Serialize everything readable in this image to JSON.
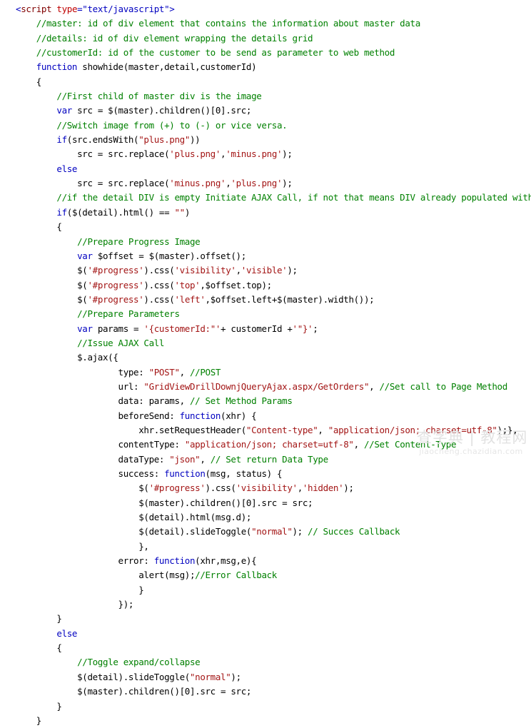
{
  "document": {
    "kind": "source-code-listing",
    "language": "JavaScript / jQuery (ASP.NET page)",
    "background_color": "#FFFFFF",
    "syntax_colors": {
      "comment": "#008000",
      "keyword": "#0000C0",
      "string": "#A31515",
      "html_tag": "#800000",
      "html_attribute": "#C00000",
      "html_bracket": "#0000C0",
      "plain_text": "#000000"
    }
  },
  "code": {
    "lines": [
      {
        "indent": 0,
        "tokens": [
          {
            "t": "br",
            "s": "<"
          },
          {
            "t": "tag",
            "s": "script "
          },
          {
            "t": "attr",
            "s": "type"
          },
          {
            "t": "val",
            "s": "=\"text/javascript\""
          },
          {
            "t": "br",
            "s": ">"
          }
        ]
      },
      {
        "indent": 1,
        "tokens": [
          {
            "t": "com",
            "s": "//master: id of div element that contains the information about master data"
          }
        ]
      },
      {
        "indent": 1,
        "tokens": [
          {
            "t": "com",
            "s": "//details: id of div element wrapping the details grid"
          }
        ]
      },
      {
        "indent": 1,
        "tokens": [
          {
            "t": "com",
            "s": "//customerId: id of the customer to be send as parameter to web method"
          }
        ]
      },
      {
        "indent": 1,
        "tokens": [
          {
            "t": "kw",
            "s": "function"
          },
          {
            "t": "plain",
            "s": " showhide(master,detail,customerId)"
          }
        ]
      },
      {
        "indent": 1,
        "tokens": [
          {
            "t": "plain",
            "s": "{"
          }
        ]
      },
      {
        "indent": 2,
        "tokens": [
          {
            "t": "com",
            "s": "//First child of master div is the image"
          }
        ]
      },
      {
        "indent": 2,
        "tokens": [
          {
            "t": "kw",
            "s": "var"
          },
          {
            "t": "plain",
            "s": " src = $(master).children()[0].src;"
          }
        ]
      },
      {
        "indent": 2,
        "tokens": [
          {
            "t": "com",
            "s": "//Switch image from (+) to (-) or vice versa."
          }
        ]
      },
      {
        "indent": 2,
        "tokens": [
          {
            "t": "kw",
            "s": "if"
          },
          {
            "t": "plain",
            "s": "(src.endsWith("
          },
          {
            "t": "str",
            "s": "\"plus.png\""
          },
          {
            "t": "plain",
            "s": "))"
          }
        ]
      },
      {
        "indent": 3,
        "tokens": [
          {
            "t": "plain",
            "s": "src = src.replace("
          },
          {
            "t": "str",
            "s": "'plus.png'"
          },
          {
            "t": "plain",
            "s": ","
          },
          {
            "t": "str",
            "s": "'minus.png'"
          },
          {
            "t": "plain",
            "s": ");"
          }
        ]
      },
      {
        "indent": 2,
        "tokens": [
          {
            "t": "kw",
            "s": "else"
          }
        ]
      },
      {
        "indent": 3,
        "tokens": [
          {
            "t": "plain",
            "s": "src = src.replace("
          },
          {
            "t": "str",
            "s": "'minus.png'"
          },
          {
            "t": "plain",
            "s": ","
          },
          {
            "t": "str",
            "s": "'plus.png'"
          },
          {
            "t": "plain",
            "s": ");"
          }
        ]
      },
      {
        "indent": 2,
        "tokens": [
          {
            "t": "com",
            "s": "//if the detail DIV is empty Initiate AJAX Call, if not that means DIV already populated with data"
          }
        ]
      },
      {
        "indent": 2,
        "tokens": [
          {
            "t": "kw",
            "s": "if"
          },
          {
            "t": "plain",
            "s": "($(detail).html() == "
          },
          {
            "t": "str",
            "s": "\"\""
          },
          {
            "t": "plain",
            "s": ")"
          }
        ]
      },
      {
        "indent": 2,
        "tokens": [
          {
            "t": "plain",
            "s": "{"
          }
        ]
      },
      {
        "indent": 3,
        "tokens": [
          {
            "t": "com",
            "s": "//Prepare Progress Image"
          }
        ]
      },
      {
        "indent": 3,
        "tokens": [
          {
            "t": "kw",
            "s": "var"
          },
          {
            "t": "plain",
            "s": " $offset = $(master).offset();"
          }
        ]
      },
      {
        "indent": 3,
        "tokens": [
          {
            "t": "plain",
            "s": "$("
          },
          {
            "t": "str",
            "s": "'#progress'"
          },
          {
            "t": "plain",
            "s": ").css("
          },
          {
            "t": "str",
            "s": "'visibility'"
          },
          {
            "t": "plain",
            "s": ","
          },
          {
            "t": "str",
            "s": "'visible'"
          },
          {
            "t": "plain",
            "s": ");"
          }
        ]
      },
      {
        "indent": 3,
        "tokens": [
          {
            "t": "plain",
            "s": "$("
          },
          {
            "t": "str",
            "s": "'#progress'"
          },
          {
            "t": "plain",
            "s": ").css("
          },
          {
            "t": "str",
            "s": "'top'"
          },
          {
            "t": "plain",
            "s": ",$offset.top);"
          }
        ]
      },
      {
        "indent": 3,
        "tokens": [
          {
            "t": "plain",
            "s": "$("
          },
          {
            "t": "str",
            "s": "'#progress'"
          },
          {
            "t": "plain",
            "s": ").css("
          },
          {
            "t": "str",
            "s": "'left'"
          },
          {
            "t": "plain",
            "s": ",$offset.left+$(master).width());"
          }
        ]
      },
      {
        "indent": 3,
        "tokens": [
          {
            "t": "com",
            "s": "//Prepare Parameters"
          }
        ]
      },
      {
        "indent": 3,
        "tokens": [
          {
            "t": "kw",
            "s": "var"
          },
          {
            "t": "plain",
            "s": " params = "
          },
          {
            "t": "str",
            "s": "'{customerId:\"'"
          },
          {
            "t": "plain",
            "s": "+ customerId +"
          },
          {
            "t": "str",
            "s": "'\"}'"
          },
          {
            "t": "plain",
            "s": ";"
          }
        ]
      },
      {
        "indent": 3,
        "tokens": [
          {
            "t": "com",
            "s": "//Issue AJAX Call"
          }
        ]
      },
      {
        "indent": 3,
        "tokens": [
          {
            "t": "plain",
            "s": "$.ajax({"
          }
        ]
      },
      {
        "indent": 5,
        "tokens": [
          {
            "t": "plain",
            "s": "type: "
          },
          {
            "t": "str",
            "s": "\"POST\""
          },
          {
            "t": "plain",
            "s": ", "
          },
          {
            "t": "com",
            "s": "//POST"
          }
        ]
      },
      {
        "indent": 5,
        "tokens": [
          {
            "t": "plain",
            "s": "url: "
          },
          {
            "t": "str",
            "s": "\"GridViewDrillDownjQueryAjax.aspx/GetOrders\""
          },
          {
            "t": "plain",
            "s": ", "
          },
          {
            "t": "com",
            "s": "//Set call to Page Method"
          }
        ]
      },
      {
        "indent": 5,
        "tokens": [
          {
            "t": "plain",
            "s": "data: params, "
          },
          {
            "t": "com",
            "s": "// Set Method Params"
          }
        ]
      },
      {
        "indent": 5,
        "tokens": [
          {
            "t": "plain",
            "s": "beforeSend: "
          },
          {
            "t": "kw",
            "s": "function"
          },
          {
            "t": "plain",
            "s": "(xhr) {"
          }
        ]
      },
      {
        "indent": 6,
        "tokens": [
          {
            "t": "plain",
            "s": "xhr.setRequestHeader("
          },
          {
            "t": "str",
            "s": "\"Content-type\""
          },
          {
            "t": "plain",
            "s": ", "
          },
          {
            "t": "str",
            "s": "\"application/json; charset=utf-8\""
          },
          {
            "t": "plain",
            "s": ");},"
          }
        ]
      },
      {
        "indent": 5,
        "tokens": [
          {
            "t": "plain",
            "s": "contentType: "
          },
          {
            "t": "str",
            "s": "\"application/json; charset=utf-8\""
          },
          {
            "t": "plain",
            "s": ", "
          },
          {
            "t": "com",
            "s": "//Set Content-Type"
          }
        ]
      },
      {
        "indent": 5,
        "tokens": [
          {
            "t": "plain",
            "s": "dataType: "
          },
          {
            "t": "str",
            "s": "\"json\""
          },
          {
            "t": "plain",
            "s": ", "
          },
          {
            "t": "com",
            "s": "// Set return Data Type"
          }
        ]
      },
      {
        "indent": 5,
        "tokens": [
          {
            "t": "plain",
            "s": "success: "
          },
          {
            "t": "kw",
            "s": "function"
          },
          {
            "t": "plain",
            "s": "(msg, status) {"
          }
        ]
      },
      {
        "indent": 6,
        "tokens": [
          {
            "t": "plain",
            "s": "$("
          },
          {
            "t": "str",
            "s": "'#progress'"
          },
          {
            "t": "plain",
            "s": ").css("
          },
          {
            "t": "str",
            "s": "'visibility'"
          },
          {
            "t": "plain",
            "s": ","
          },
          {
            "t": "str",
            "s": "'hidden'"
          },
          {
            "t": "plain",
            "s": ");"
          }
        ]
      },
      {
        "indent": 6,
        "tokens": [
          {
            "t": "plain",
            "s": "$(master).children()[0].src = src;"
          }
        ]
      },
      {
        "indent": 6,
        "tokens": [
          {
            "t": "plain",
            "s": "$(detail).html(msg.d);"
          }
        ]
      },
      {
        "indent": 6,
        "tokens": [
          {
            "t": "plain",
            "s": "$(detail).slideToggle("
          },
          {
            "t": "str",
            "s": "\"normal\""
          },
          {
            "t": "plain",
            "s": "); "
          },
          {
            "t": "com",
            "s": "// Succes Callback"
          }
        ]
      },
      {
        "indent": 6,
        "tokens": [
          {
            "t": "plain",
            "s": "},"
          }
        ]
      },
      {
        "indent": 5,
        "tokens": [
          {
            "t": "plain",
            "s": "error: "
          },
          {
            "t": "kw",
            "s": "function"
          },
          {
            "t": "plain",
            "s": "(xhr,msg,e){"
          }
        ]
      },
      {
        "indent": 6,
        "tokens": [
          {
            "t": "plain",
            "s": "alert(msg);"
          },
          {
            "t": "com",
            "s": "//Error Callback"
          }
        ]
      },
      {
        "indent": 6,
        "tokens": [
          {
            "t": "plain",
            "s": "}"
          }
        ]
      },
      {
        "indent": 5,
        "tokens": [
          {
            "t": "plain",
            "s": "});"
          }
        ]
      },
      {
        "indent": 2,
        "tokens": [
          {
            "t": "plain",
            "s": "}"
          }
        ]
      },
      {
        "indent": 2,
        "tokens": [
          {
            "t": "kw",
            "s": "else"
          }
        ]
      },
      {
        "indent": 2,
        "tokens": [
          {
            "t": "plain",
            "s": "{"
          }
        ]
      },
      {
        "indent": 3,
        "tokens": [
          {
            "t": "com",
            "s": "//Toggle expand/collapse"
          }
        ]
      },
      {
        "indent": 3,
        "tokens": [
          {
            "t": "plain",
            "s": "$(detail).slideToggle("
          },
          {
            "t": "str",
            "s": "\"normal\""
          },
          {
            "t": "plain",
            "s": ");"
          }
        ]
      },
      {
        "indent": 3,
        "tokens": [
          {
            "t": "plain",
            "s": "$(master).children()[0].src = src;"
          }
        ]
      },
      {
        "indent": 2,
        "tokens": [
          {
            "t": "plain",
            "s": "}"
          }
        ]
      },
      {
        "indent": 1,
        "tokens": [
          {
            "t": "plain",
            "s": "}"
          }
        ]
      }
    ]
  },
  "watermark": {
    "main_text": "查字典 | 教程网",
    "sub_text": "jiaocheng.chazidian.com",
    "color": "#E2E2E2"
  }
}
